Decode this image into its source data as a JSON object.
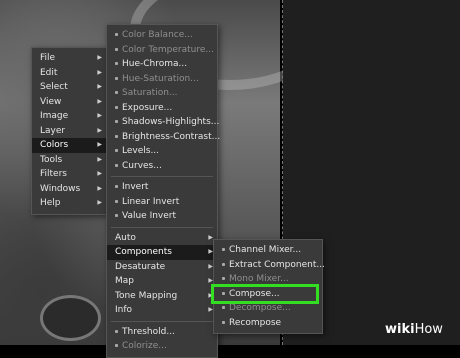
{
  "main_menu": [
    "File",
    "Edit",
    "Select",
    "View",
    "Image",
    "Layer",
    "Colors",
    "Tools",
    "Filters",
    "Windows",
    "Help"
  ],
  "colors_menu": {
    "group1": [
      {
        "label": "Color Balance...",
        "disabled": true
      },
      {
        "label": "Color Temperature...",
        "disabled": true
      },
      {
        "label": "Hue-Chroma...",
        "disabled": false
      },
      {
        "label": "Hue-Saturation...",
        "disabled": true
      },
      {
        "label": "Saturation...",
        "disabled": true
      },
      {
        "label": "Exposure...",
        "disabled": false
      },
      {
        "label": "Shadows-Highlights...",
        "disabled": false
      },
      {
        "label": "Brightness-Contrast...",
        "disabled": false
      },
      {
        "label": "Levels...",
        "disabled": false
      },
      {
        "label": "Curves...",
        "disabled": false
      }
    ],
    "group2": [
      "Invert",
      "Linear Invert",
      "Value Invert"
    ],
    "group3": [
      "Auto",
      "Components",
      "Desaturate",
      "Map",
      "Tone Mapping",
      "Info"
    ],
    "group4": [
      {
        "label": "Threshold...",
        "disabled": false
      },
      {
        "label": "Colorize...",
        "disabled": true
      }
    ]
  },
  "components_menu": [
    {
      "label": "Channel Mixer...",
      "disabled": false
    },
    {
      "label": "Extract Component...",
      "disabled": false
    },
    {
      "label": "Mono Mixer...",
      "disabled": true
    },
    {
      "label": "Compose...",
      "disabled": false
    },
    {
      "label": "Decompose...",
      "disabled": true
    },
    {
      "label": "Recompose",
      "disabled": false
    }
  ],
  "watermark": {
    "bold": "wiki",
    "thin": "How"
  },
  "colors": {
    "highlight_box": "#33dd22",
    "menu_bg": "#3a3a3a"
  }
}
